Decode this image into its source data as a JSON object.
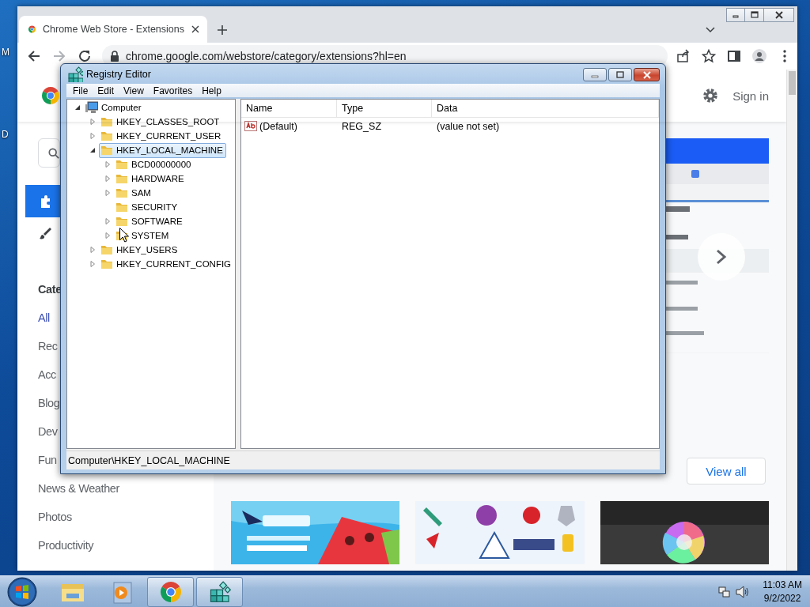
{
  "desktop": {
    "icon_labels": [
      "M",
      "D"
    ]
  },
  "browser": {
    "tabs": [
      {
        "title": "Chrome Web Store - Extensions",
        "selected": true
      }
    ],
    "address": "chrome.google.com/webstore/category/extensions?hl=en",
    "sign_in": "Sign in",
    "nav": [
      {
        "kind": "extensions",
        "selected": true
      },
      {
        "kind": "themes",
        "selected": false
      }
    ],
    "categories_heading": "Cate",
    "categories": [
      {
        "label": "All",
        "selected": true
      },
      {
        "label": "Rec",
        "selected": false
      },
      {
        "label": "Acc",
        "selected": false
      },
      {
        "label": "Blog",
        "selected": false
      },
      {
        "label": "Dev",
        "selected": false
      },
      {
        "label": "Fun",
        "selected": false
      },
      {
        "label": "News & Weather",
        "selected": false
      },
      {
        "label": "Photos",
        "selected": false
      },
      {
        "label": "Productivity",
        "selected": false
      }
    ],
    "view_all": "View all"
  },
  "registry_editor": {
    "title": "Registry Editor",
    "menu": [
      "File",
      "Edit",
      "View",
      "Favorites",
      "Help"
    ],
    "tree": [
      {
        "label": "Computer",
        "kind": "computer",
        "expandable": true,
        "expanded": true,
        "selected": false,
        "children": [
          {
            "label": "HKEY_CLASSES_ROOT",
            "kind": "folder",
            "expandable": true,
            "expanded": false,
            "selected": false
          },
          {
            "label": "HKEY_CURRENT_USER",
            "kind": "folder",
            "expandable": true,
            "expanded": false,
            "selected": false
          },
          {
            "label": "HKEY_LOCAL_MACHINE",
            "kind": "folder",
            "expandable": true,
            "expanded": true,
            "selected": true,
            "children": [
              {
                "label": "BCD00000000",
                "kind": "folder",
                "expandable": true,
                "expanded": false,
                "selected": false
              },
              {
                "label": "HARDWARE",
                "kind": "folder",
                "expandable": true,
                "expanded": false,
                "selected": false
              },
              {
                "label": "SAM",
                "kind": "folder",
                "expandable": true,
                "expanded": false,
                "selected": false
              },
              {
                "label": "SECURITY",
                "kind": "folder",
                "expandable": false,
                "expanded": false,
                "selected": false
              },
              {
                "label": "SOFTWARE",
                "kind": "folder",
                "expandable": true,
                "expanded": false,
                "selected": false
              },
              {
                "label": "SYSTEM",
                "kind": "folder",
                "expandable": true,
                "expanded": false,
                "selected": false
              }
            ]
          },
          {
            "label": "HKEY_USERS",
            "kind": "folder",
            "expandable": true,
            "expanded": false,
            "selected": false
          },
          {
            "label": "HKEY_CURRENT_CONFIG",
            "kind": "folder",
            "expandable": true,
            "expanded": false,
            "selected": false
          }
        ]
      }
    ],
    "columns": [
      "Name",
      "Type",
      "Data"
    ],
    "rows": [
      {
        "kind": "string",
        "name": "(Default)",
        "type": "REG_SZ",
        "data": "(value not set)"
      }
    ],
    "status_bar": "Computer\\HKEY_LOCAL_MACHINE"
  },
  "taskbar": {
    "apps": [
      {
        "kind": "explorer",
        "open": false
      },
      {
        "kind": "media",
        "open": false
      },
      {
        "kind": "chrome",
        "open": true
      },
      {
        "kind": "regedit",
        "open": true
      }
    ],
    "time": "11:03 AM",
    "date": "9/2/2022"
  }
}
